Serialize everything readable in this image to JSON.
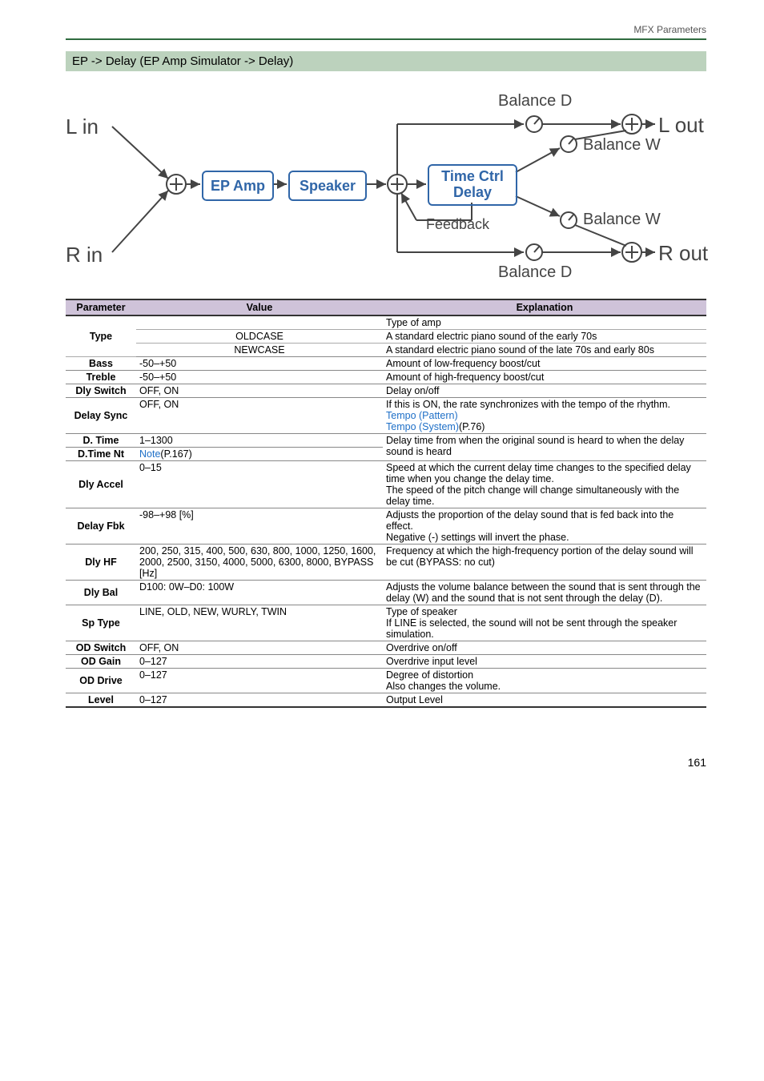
{
  "header": {
    "section": "MFX Parameters"
  },
  "title": "EP -> Delay (EP Amp Simulator -> Delay)",
  "diagram": {
    "l_in": "L in",
    "r_in": "R in",
    "l_out": "L out",
    "r_out": "R out",
    "ep_amp": "EP Amp",
    "speaker": "Speaker",
    "delay_l1": "Time Ctrl",
    "delay_l2": "Delay",
    "balance_d_top": "Balance D",
    "balance_d_bot": "Balance D",
    "balance_w_top": "Balance W",
    "balance_w_bot": "Balance W",
    "feedback": "Feedback"
  },
  "table": {
    "headers": {
      "param": "Parameter",
      "value": "Value",
      "expl": "Explanation"
    },
    "rows": {
      "type": {
        "param": "Type",
        "r0": {
          "value": "",
          "expl": "Type of amp"
        },
        "r1": {
          "value": "OLDCASE",
          "expl": "A standard electric piano sound of the early 70s"
        },
        "r2": {
          "value": "NEWCASE",
          "expl": "A standard electric piano sound of the late 70s and early 80s"
        }
      },
      "bass": {
        "param": "Bass",
        "value": "-50–+50",
        "expl": "Amount of low-frequency boost/cut"
      },
      "treble": {
        "param": "Treble",
        "value": "-50–+50",
        "expl": "Amount of high-frequency boost/cut"
      },
      "dlysw": {
        "param": "Dly Switch",
        "value": "OFF, ON",
        "expl": "Delay on/off"
      },
      "dsync": {
        "param": "Delay Sync",
        "value": "OFF, ON",
        "expl_l1": "If this is ON, the rate synchronizes with the tempo of the rhythm.",
        "link1": "Tempo (Pattern)",
        "link2_a": "Tempo (System)",
        "link2_b": "(P.76)"
      },
      "dtime": {
        "param": "D. Time",
        "value": "1–1300",
        "expl": "Delay time from when the original sound is heard to when the delay sound is heard"
      },
      "dtnt": {
        "param": "D.Time Nt",
        "value_a": "Note",
        "value_b": "(P.167)",
        "expl": ""
      },
      "accel": {
        "param": "Dly Accel",
        "value": "0–15",
        "expl": "Speed at which the current delay time changes to the specified delay time when you change the delay time.\nThe speed of the pitch change will change simultaneously with the delay time."
      },
      "fbk": {
        "param": "Delay Fbk",
        "value": "-98–+98 [%]",
        "expl": "Adjusts the proportion of the delay sound that is fed back into the effect.\nNegative (-) settings will invert the phase."
      },
      "hf": {
        "param": "Dly HF",
        "value": "200, 250, 315, 400, 500, 630, 800, 1000, 1250, 1600, 2000, 2500, 3150, 4000, 5000, 6300, 8000, BYPASS [Hz]",
        "expl": "Frequency at which the high-frequency portion of the delay sound will be cut (BYPASS: no cut)"
      },
      "bal": {
        "param": "Dly Bal",
        "value": "D100: 0W–D0: 100W",
        "expl": "Adjusts the volume balance between the sound that is sent through the delay (W) and the sound that is not sent through the delay (D)."
      },
      "sptype": {
        "param": "Sp Type",
        "value": "LINE, OLD, NEW, WURLY, TWIN",
        "expl": "Type of speaker\nIf LINE is selected, the sound will not be sent through the speaker simulation."
      },
      "odsw": {
        "param": "OD Switch",
        "value": "OFF, ON",
        "expl": "Overdrive on/off"
      },
      "odgain": {
        "param": "OD Gain",
        "value": "0–127",
        "expl": "Overdrive input level"
      },
      "oddrv": {
        "param": "OD Drive",
        "value": "0–127",
        "expl": "Degree of distortion\nAlso changes the volume."
      },
      "level": {
        "param": "Level",
        "value": "0–127",
        "expl": "Output Level"
      }
    }
  },
  "page_number": "161"
}
